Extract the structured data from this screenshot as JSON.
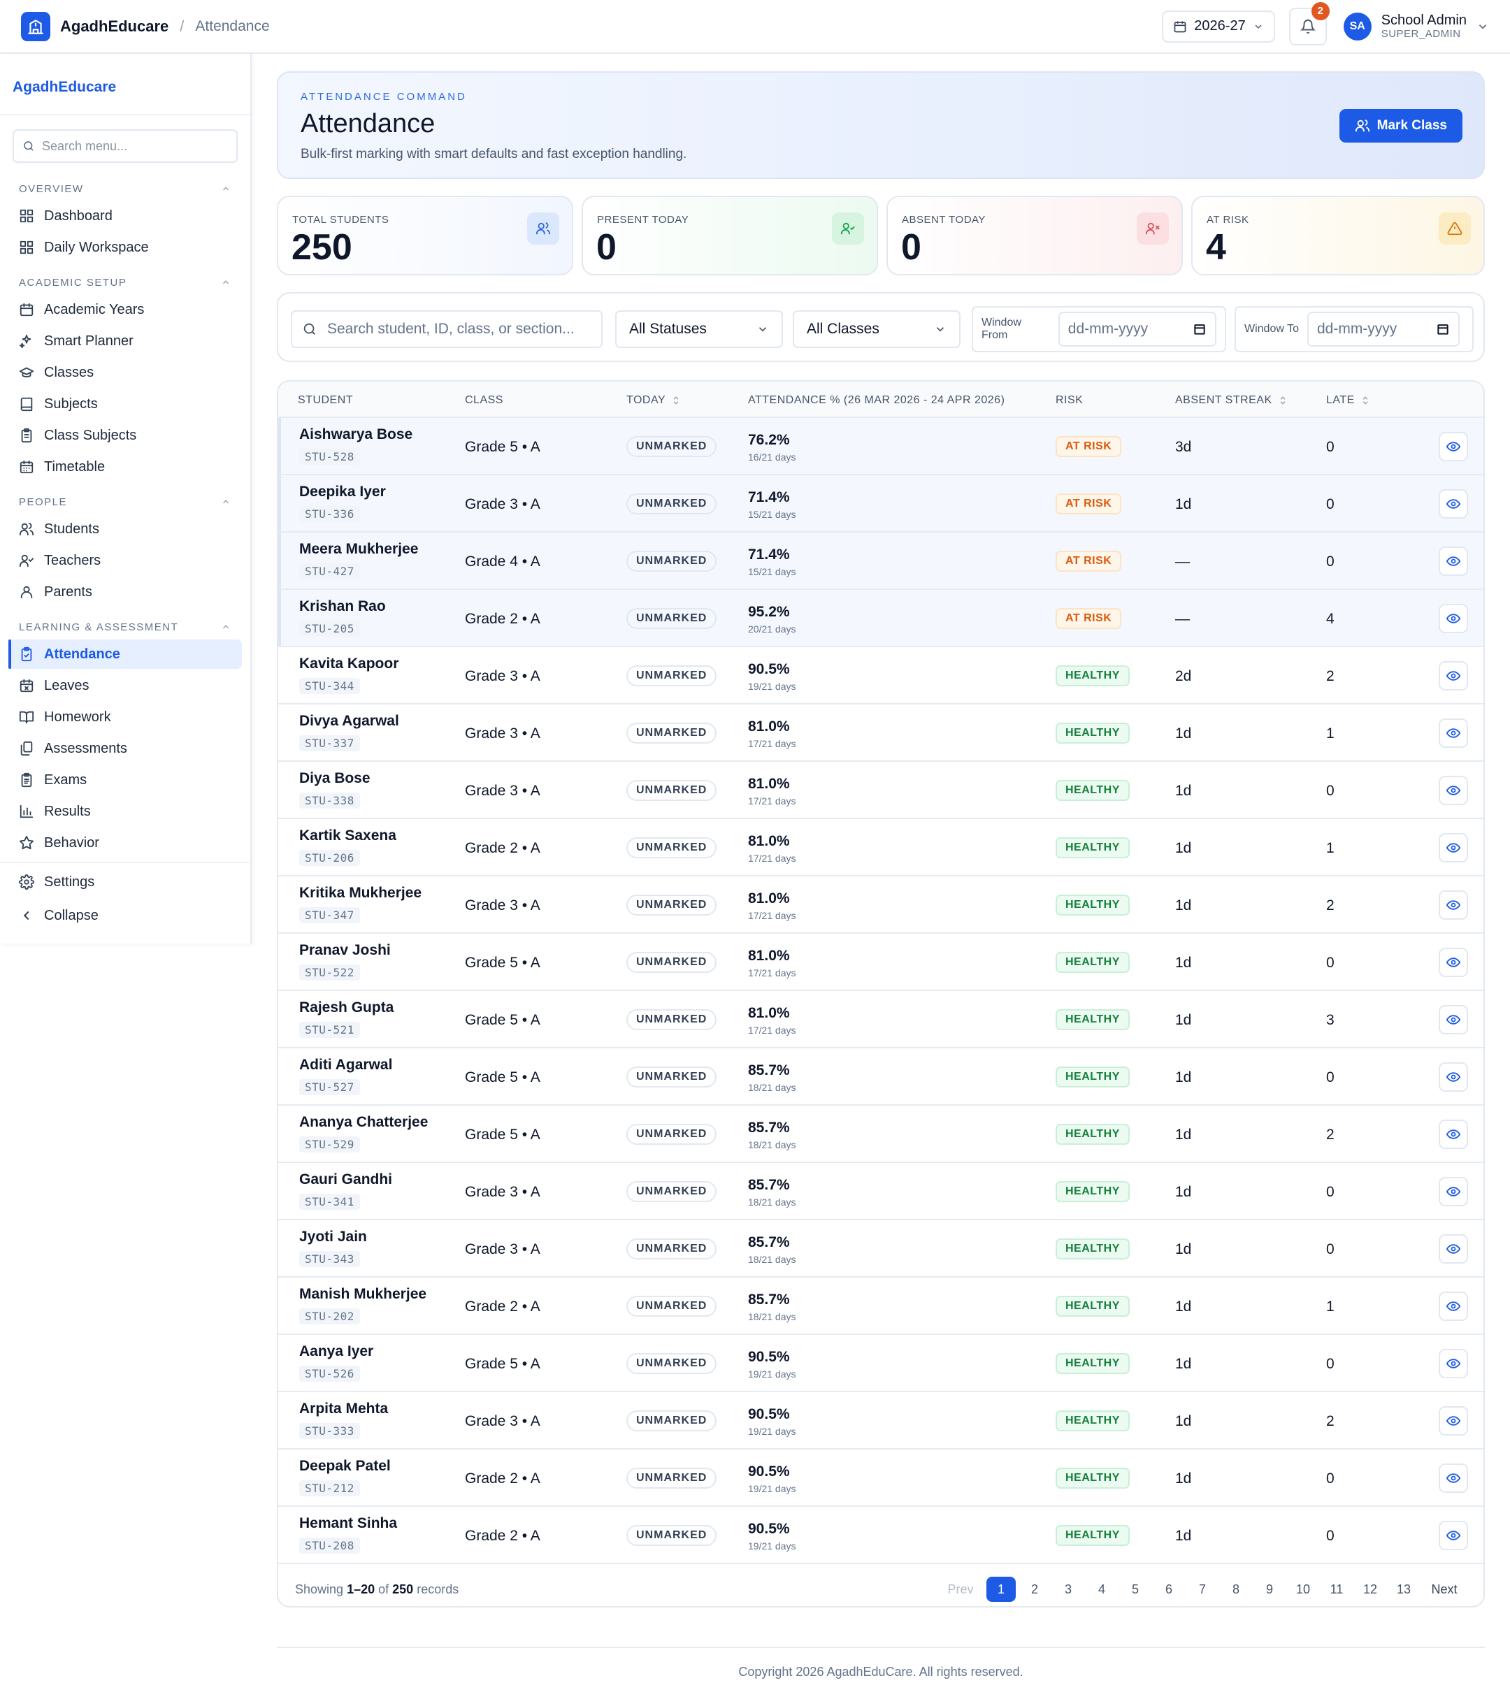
{
  "topbar": {
    "brand": "AgadhEducare",
    "breadcrumb": "Attendance",
    "year": "2026-27",
    "notifications": "2",
    "avatar_initials": "SA",
    "user_name": "School Admin",
    "user_role": "SUPER_ADMIN"
  },
  "sidebar": {
    "brand": "AgadhEducare",
    "search_placeholder": "Search menu...",
    "sections": [
      {
        "title": "OVERVIEW",
        "items": [
          {
            "label": "Dashboard",
            "icon": "grid-icon"
          },
          {
            "label": "Daily Workspace",
            "icon": "grid-icon"
          }
        ]
      },
      {
        "title": "ACADEMIC SETUP",
        "items": [
          {
            "label": "Academic Years",
            "icon": "calendar-icon"
          },
          {
            "label": "Smart Planner",
            "icon": "sparkles-icon"
          },
          {
            "label": "Classes",
            "icon": "graduation-cap-icon"
          },
          {
            "label": "Subjects",
            "icon": "book-icon"
          },
          {
            "label": "Class Subjects",
            "icon": "clipboard-icon"
          },
          {
            "label": "Timetable",
            "icon": "calendar-grid-icon"
          }
        ]
      },
      {
        "title": "PEOPLE",
        "items": [
          {
            "label": "Students",
            "icon": "users-icon"
          },
          {
            "label": "Teachers",
            "icon": "user-check-icon"
          },
          {
            "label": "Parents",
            "icon": "user-icon"
          }
        ]
      },
      {
        "title": "LEARNING & ASSESSMENT",
        "items": [
          {
            "label": "Attendance",
            "icon": "clipboard-check-icon",
            "active": true
          },
          {
            "label": "Leaves",
            "icon": "calendar-x-icon"
          },
          {
            "label": "Homework",
            "icon": "book-open-icon"
          },
          {
            "label": "Assessments",
            "icon": "files-icon"
          },
          {
            "label": "Exams",
            "icon": "clipboard-list-icon"
          },
          {
            "label": "Results",
            "icon": "bar-chart-icon"
          },
          {
            "label": "Behavior",
            "icon": "star-icon"
          }
        ]
      }
    ],
    "settings": "Settings",
    "collapse": "Collapse"
  },
  "hero": {
    "eyebrow": "ATTENDANCE COMMAND",
    "title": "Attendance",
    "subtitle": "Bulk-first marking with smart defaults and fast exception handling.",
    "button": "Mark Class"
  },
  "stats": [
    {
      "label": "TOTAL STUDENTS",
      "value": "250",
      "icon": "users-icon",
      "color": "#2f6ae3"
    },
    {
      "label": "PRESENT TODAY",
      "value": "0",
      "icon": "user-check-icon",
      "color": "#16a34a"
    },
    {
      "label": "ABSENT TODAY",
      "value": "0",
      "icon": "user-x-icon",
      "color": "#e0505a"
    },
    {
      "label": "AT RISK",
      "value": "4",
      "icon": "alert-triangle-icon",
      "color": "#d97706"
    }
  ],
  "filters": {
    "search_placeholder": "Search student, ID, class, or section...",
    "status": "All Statuses",
    "class": "All Classes",
    "window_from_label": "Window From",
    "window_from_placeholder": "dd-mm-yyyy",
    "window_to_label": "Window To",
    "window_to_placeholder": "dd-mm-yyyy"
  },
  "table": {
    "headers": {
      "student": "STUDENT",
      "class": "CLASS",
      "today": "TODAY",
      "attendance": "ATTENDANCE % (26 MAR 2026 - 24 APR 2026)",
      "risk": "RISK",
      "streak": "ABSENT STREAK",
      "late": "LATE"
    },
    "rows": [
      {
        "name": "Aishwarya Bose",
        "id": "STU-528",
        "class": "Grade 5 • A",
        "today": "UNMARKED",
        "pct": "76.2%",
        "days": "16/21 days",
        "risk": "AT RISK",
        "streak": "3d",
        "late": "0"
      },
      {
        "name": "Deepika Iyer",
        "id": "STU-336",
        "class": "Grade 3 • A",
        "today": "UNMARKED",
        "pct": "71.4%",
        "days": "15/21 days",
        "risk": "AT RISK",
        "streak": "1d",
        "late": "0"
      },
      {
        "name": "Meera Mukherjee",
        "id": "STU-427",
        "class": "Grade 4 • A",
        "today": "UNMARKED",
        "pct": "71.4%",
        "days": "15/21 days",
        "risk": "AT RISK",
        "streak": "—",
        "late": "0"
      },
      {
        "name": "Krishan Rao",
        "id": "STU-205",
        "class": "Grade 2 • A",
        "today": "UNMARKED",
        "pct": "95.2%",
        "days": "20/21 days",
        "risk": "AT RISK",
        "streak": "—",
        "late": "4"
      },
      {
        "name": "Kavita Kapoor",
        "id": "STU-344",
        "class": "Grade 3 • A",
        "today": "UNMARKED",
        "pct": "90.5%",
        "days": "19/21 days",
        "risk": "HEALTHY",
        "streak": "2d",
        "late": "2"
      },
      {
        "name": "Divya Agarwal",
        "id": "STU-337",
        "class": "Grade 3 • A",
        "today": "UNMARKED",
        "pct": "81.0%",
        "days": "17/21 days",
        "risk": "HEALTHY",
        "streak": "1d",
        "late": "1"
      },
      {
        "name": "Diya Bose",
        "id": "STU-338",
        "class": "Grade 3 • A",
        "today": "UNMARKED",
        "pct": "81.0%",
        "days": "17/21 days",
        "risk": "HEALTHY",
        "streak": "1d",
        "late": "0"
      },
      {
        "name": "Kartik Saxena",
        "id": "STU-206",
        "class": "Grade 2 • A",
        "today": "UNMARKED",
        "pct": "81.0%",
        "days": "17/21 days",
        "risk": "HEALTHY",
        "streak": "1d",
        "late": "1"
      },
      {
        "name": "Kritika Mukherjee",
        "id": "STU-347",
        "class": "Grade 3 • A",
        "today": "UNMARKED",
        "pct": "81.0%",
        "days": "17/21 days",
        "risk": "HEALTHY",
        "streak": "1d",
        "late": "2"
      },
      {
        "name": "Pranav Joshi",
        "id": "STU-522",
        "class": "Grade 5 • A",
        "today": "UNMARKED",
        "pct": "81.0%",
        "days": "17/21 days",
        "risk": "HEALTHY",
        "streak": "1d",
        "late": "0"
      },
      {
        "name": "Rajesh Gupta",
        "id": "STU-521",
        "class": "Grade 5 • A",
        "today": "UNMARKED",
        "pct": "81.0%",
        "days": "17/21 days",
        "risk": "HEALTHY",
        "streak": "1d",
        "late": "3"
      },
      {
        "name": "Aditi Agarwal",
        "id": "STU-527",
        "class": "Grade 5 • A",
        "today": "UNMARKED",
        "pct": "85.7%",
        "days": "18/21 days",
        "risk": "HEALTHY",
        "streak": "1d",
        "late": "0"
      },
      {
        "name": "Ananya Chatterjee",
        "id": "STU-529",
        "class": "Grade 5 • A",
        "today": "UNMARKED",
        "pct": "85.7%",
        "days": "18/21 days",
        "risk": "HEALTHY",
        "streak": "1d",
        "late": "2"
      },
      {
        "name": "Gauri Gandhi",
        "id": "STU-341",
        "class": "Grade 3 • A",
        "today": "UNMARKED",
        "pct": "85.7%",
        "days": "18/21 days",
        "risk": "HEALTHY",
        "streak": "1d",
        "late": "0"
      },
      {
        "name": "Jyoti Jain",
        "id": "STU-343",
        "class": "Grade 3 • A",
        "today": "UNMARKED",
        "pct": "85.7%",
        "days": "18/21 days",
        "risk": "HEALTHY",
        "streak": "1d",
        "late": "0"
      },
      {
        "name": "Manish Mukherjee",
        "id": "STU-202",
        "class": "Grade 2 • A",
        "today": "UNMARKED",
        "pct": "85.7%",
        "days": "18/21 days",
        "risk": "HEALTHY",
        "streak": "1d",
        "late": "1"
      },
      {
        "name": "Aanya Iyer",
        "id": "STU-526",
        "class": "Grade 5 • A",
        "today": "UNMARKED",
        "pct": "90.5%",
        "days": "19/21 days",
        "risk": "HEALTHY",
        "streak": "1d",
        "late": "0"
      },
      {
        "name": "Arpita Mehta",
        "id": "STU-333",
        "class": "Grade 3 • A",
        "today": "UNMARKED",
        "pct": "90.5%",
        "days": "19/21 days",
        "risk": "HEALTHY",
        "streak": "1d",
        "late": "2"
      },
      {
        "name": "Deepak Patel",
        "id": "STU-212",
        "class": "Grade 2 • A",
        "today": "UNMARKED",
        "pct": "90.5%",
        "days": "19/21 days",
        "risk": "HEALTHY",
        "streak": "1d",
        "late": "0"
      },
      {
        "name": "Hemant Sinha",
        "id": "STU-208",
        "class": "Grade 2 • A",
        "today": "UNMARKED",
        "pct": "90.5%",
        "days": "19/21 days",
        "risk": "HEALTHY",
        "streak": "1d",
        "late": "0"
      }
    ]
  },
  "pagination": {
    "showing_prefix": "Showing",
    "range": "1–20",
    "of": "of",
    "total": "250",
    "suffix": "records",
    "prev": "Prev",
    "pages": [
      "1",
      "2",
      "3",
      "4",
      "5",
      "6",
      "7",
      "8",
      "9",
      "10",
      "11",
      "12",
      "13"
    ],
    "current": "1",
    "next": "Next"
  },
  "footer": "Copyright 2026 AgadhEduCare. All rights reserved."
}
